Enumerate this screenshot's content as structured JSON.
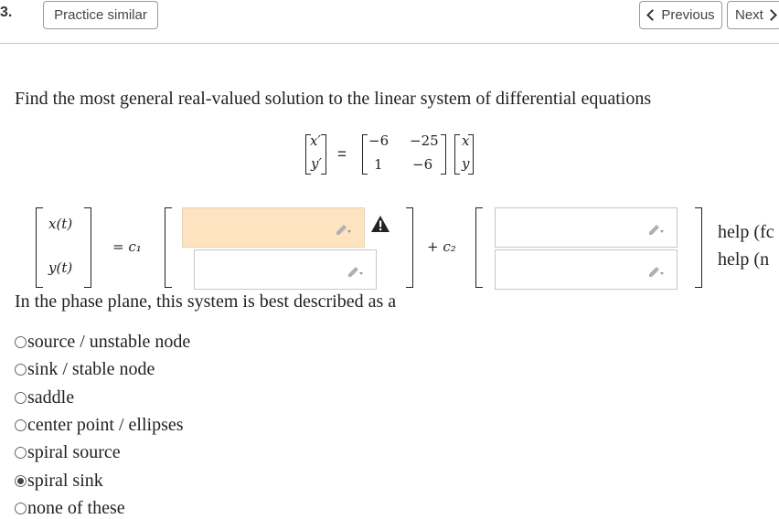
{
  "header": {
    "question_number": "3.",
    "practice_button": "Practice similar",
    "previous_button": "Previous",
    "next_button": "Next"
  },
  "prompt": "Find the most general real-valued solution to the linear system of differential equations",
  "system": {
    "lhs_top": "x′",
    "lhs_bottom": "y′",
    "equals": "=",
    "matrix": [
      [
        "−6",
        "−25"
      ],
      [
        "1",
        "−6"
      ]
    ],
    "rhs_top": "x",
    "rhs_bottom": "y"
  },
  "solution": {
    "vec_top": "x(t)",
    "vec_bottom": "y(t)",
    "eq_c1": "= c₁",
    "plus_c2": "+ c₂",
    "inputs": [
      "",
      "",
      "",
      ""
    ]
  },
  "help": [
    "help (fc",
    "help (n"
  ],
  "phase_question": "In the phase plane, this system is best described as a",
  "options": [
    {
      "label": "source / unstable node",
      "selected": false
    },
    {
      "label": "sink / stable node",
      "selected": false
    },
    {
      "label": "saddle",
      "selected": false
    },
    {
      "label": "center point / ellipses",
      "selected": false
    },
    {
      "label": "spiral source",
      "selected": false
    },
    {
      "label": "spiral sink",
      "selected": true
    },
    {
      "label": "none of these",
      "selected": false
    }
  ],
  "colors": {
    "warning_fill": "#fde3c0",
    "border": "#c7c7c7"
  },
  "icons": [
    "chevron-left-icon",
    "chevron-right-icon",
    "pencil-icon",
    "warning-icon"
  ]
}
